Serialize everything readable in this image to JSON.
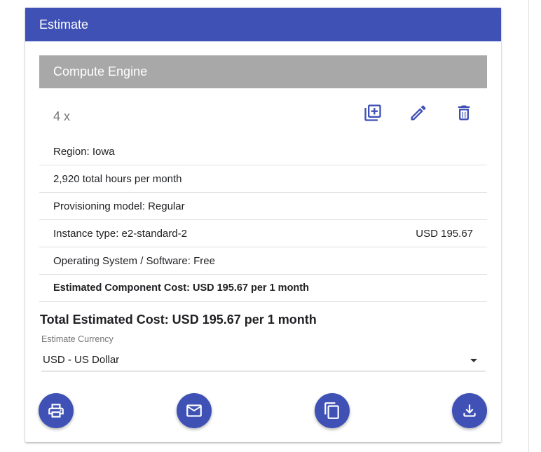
{
  "card": {
    "title": "Estimate"
  },
  "section": {
    "title": "Compute Engine",
    "quantity": "4 x",
    "actions": [
      {
        "name": "duplicate",
        "icon": "library-add-icon"
      },
      {
        "name": "edit",
        "icon": "pencil-icon"
      },
      {
        "name": "delete",
        "icon": "trash-icon"
      }
    ],
    "rows": [
      {
        "label": "Region: Iowa",
        "value": ""
      },
      {
        "label": "2,920 total hours per month",
        "value": ""
      },
      {
        "label": "Provisioning model: Regular",
        "value": ""
      },
      {
        "label": "Instance type: e2-standard-2",
        "value": "USD 195.67"
      },
      {
        "label": "Operating System / Software: Free",
        "value": ""
      },
      {
        "label": "Estimated Component Cost: USD 195.67 per 1 month",
        "value": ""
      }
    ]
  },
  "total": {
    "text": "Total Estimated Cost: USD 195.67 per 1 month"
  },
  "currency": {
    "label": "Estimate Currency",
    "selected": "USD - US Dollar"
  },
  "actions": [
    {
      "name": "print",
      "icon": "print-icon"
    },
    {
      "name": "email",
      "icon": "email-icon"
    },
    {
      "name": "copy",
      "icon": "copy-icon"
    },
    {
      "name": "download",
      "icon": "download-icon"
    }
  ],
  "colors": {
    "primary": "#3f51b5",
    "section_bar": "#a8a8a8",
    "divider": "#e0e0e0"
  }
}
